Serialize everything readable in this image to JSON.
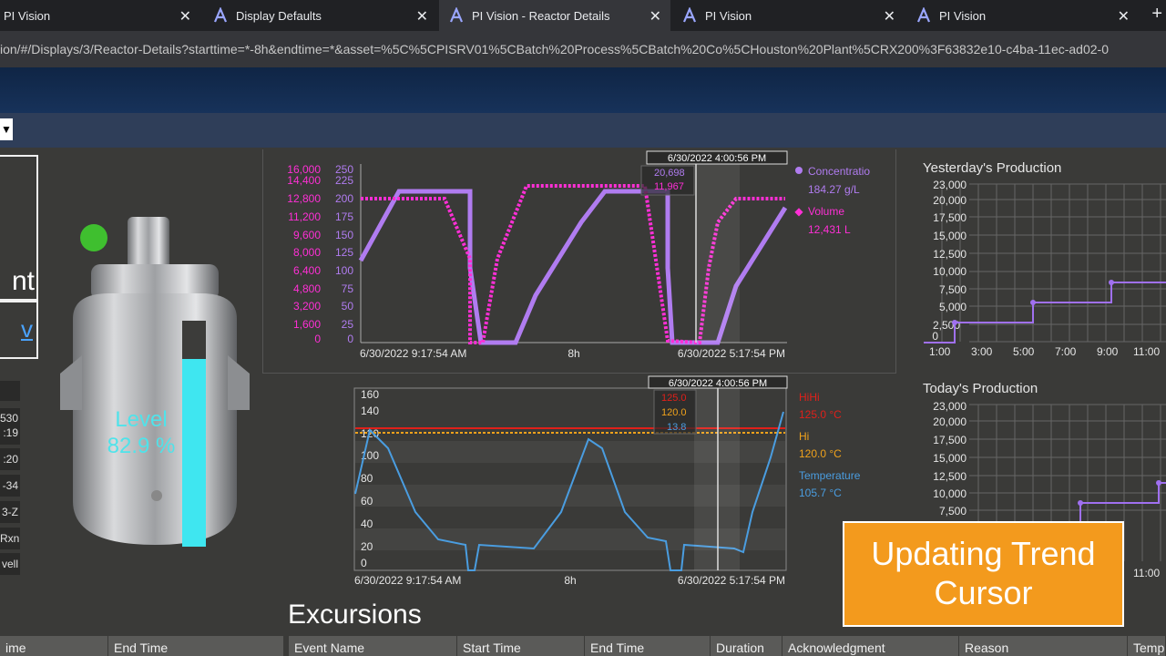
{
  "browser": {
    "tabs": [
      {
        "label": "PI Vision",
        "active": false
      },
      {
        "label": "Display Defaults",
        "active": false
      },
      {
        "label": "PI Vision - Reactor Details",
        "active": true
      },
      {
        "label": "PI Vision",
        "active": false
      },
      {
        "label": "PI Vision",
        "active": false
      }
    ],
    "url": "ion/#/Displays/3/Reactor-Details?starttime=*-8h&endtime=*&asset=%5C%5CPISRV01%5CBatch%20Process%5CBatch%20Co%5CHouston%20Plant%5CRX200%3F63832e10-c4ba-11ec-ad02-0"
  },
  "toolbar": {
    "dropdown_glyph": "▼"
  },
  "left_panel": {
    "partial_word_1": "nt",
    "partial_word_2": "v",
    "list_items": [
      "530",
      ":19",
      ":20",
      "-34",
      "3-Z",
      "Rxn",
      "vell"
    ]
  },
  "reactor": {
    "status_color": "#3fbf2f",
    "level_label": "Level",
    "level_value": "82.9 %",
    "level_fraction": 0.829
  },
  "trend1": {
    "cursor_time": "6/30/2022 4:00:56 PM",
    "cursor_val_1": "20,698",
    "cursor_val_2": "11,967",
    "start_label": "6/30/2022 9:17:54 AM",
    "mid_label": "8h",
    "end_label": "6/30/2022 5:17:54 PM",
    "left_ticks": [
      "16,000",
      "14,400",
      "12,800",
      "11,200",
      "9,600",
      "8,000",
      "6,400",
      "4,800",
      "3,200",
      "1,600",
      "0"
    ],
    "right_ticks": [
      "250",
      "225",
      "200",
      "175",
      "150",
      "125",
      "100",
      "75",
      "50",
      "25",
      "0"
    ],
    "legend": [
      {
        "name": "Concentratio",
        "value": "184.27 g/L",
        "color": "#b07cf0"
      },
      {
        "name": "Volume",
        "value": "12,431 L",
        "color": "#ff2fd6"
      }
    ]
  },
  "trend2": {
    "cursor_time": "6/30/2022 4:00:56 PM",
    "cursor_val_hihi": "125.0",
    "cursor_val_hi": "120.0",
    "cursor_val_temp": "13.8",
    "start_label": "6/30/2022 9:17:54 AM",
    "mid_label": "8h",
    "end_label": "6/30/2022 5:17:54 PM",
    "ticks": [
      "160",
      "140",
      "120",
      "100",
      "80",
      "60",
      "40",
      "20",
      "0"
    ],
    "legend": [
      {
        "name": "HiHi",
        "value": "125.0 °C",
        "color": "#e0201a"
      },
      {
        "name": "Hi",
        "value": "120.0 °C",
        "color": "#f0a21b"
      },
      {
        "name": "Temperature",
        "value": "105.7 °C",
        "color": "#4a9de0"
      }
    ]
  },
  "yesterday": {
    "title": "Yesterday's Production",
    "yticks": [
      "23,000",
      "20,000",
      "17,500",
      "15,000",
      "12,500",
      "10,000",
      "7,500",
      "5,000",
      "2,500",
      "0"
    ],
    "xticks": [
      "1:00",
      "3:00",
      "5:00",
      "7:00",
      "9:00",
      "11:00"
    ]
  },
  "today": {
    "title": "Today's Production",
    "yticks": [
      "23,000",
      "20,000",
      "17,500",
      "15,000",
      "12,500",
      "10,000",
      "7,500"
    ],
    "xtick_last": "11:00"
  },
  "callout": {
    "line1": "Updating Trend",
    "line2": "Cursor"
  },
  "excursions": {
    "title": "Excursions",
    "left_headers": [
      "ime",
      "End Time"
    ],
    "headers": [
      "Event Name",
      "Start Time",
      "End Time",
      "Duration",
      "Acknowledgment",
      "Reason",
      "Temp"
    ]
  },
  "colors": {
    "concentration": "#b07cf0",
    "volume": "#ff2fd6",
    "temperature": "#4a9de0",
    "hihi": "#e0201a",
    "hi": "#f0a21b",
    "production": "#a070f0"
  }
}
